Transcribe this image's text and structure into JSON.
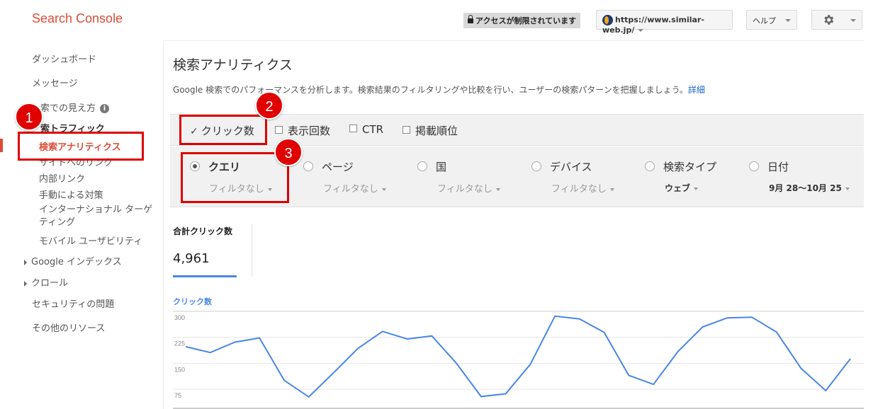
{
  "header": {
    "brand": "Search Console",
    "restricted_label": "アクセスが制限されています",
    "site": "https://www.similar-web.jp/",
    "help": "ヘルプ"
  },
  "sidebar": {
    "dashboard": "ダッシュボード",
    "messages": "メッセージ",
    "search_appearance": "索での見え方",
    "search_traffic": "索トラフィック",
    "search_analytics": "検索アナリティクス",
    "links_to_site": "サイトへのリンク",
    "internal_links": "内部リンク",
    "manual_actions": "手動による対策",
    "intl_targeting": "インターナショナル ターゲティング",
    "mobile_usability": "モバイル ユーザビリティ",
    "google_index": "Google インデックス",
    "crawl": "クロール",
    "security": "セキュリティの問題",
    "other_resources": "その他のリソース"
  },
  "main": {
    "title": "検索アナリティクス",
    "description": "Google 検索でのパフォーマンスを分析します。検索結果のフィルタリングや比較を行い、ユーザーの検索パターンを把握しましょう。",
    "description_link": "詳細",
    "metrics": [
      {
        "label": "クリック数",
        "checked": true
      },
      {
        "label": "表示回数",
        "checked": false
      },
      {
        "label": "CTR",
        "checked": false
      },
      {
        "label": "掲載順位",
        "checked": false
      }
    ],
    "groups": [
      {
        "label": "クエリ",
        "filter": "フィルタなし",
        "selected": true
      },
      {
        "label": "ページ",
        "filter": "フィルタなし",
        "selected": false
      },
      {
        "label": "国",
        "filter": "フィルタなし",
        "selected": false
      },
      {
        "label": "デバイス",
        "filter": "フィルタなし",
        "selected": false
      },
      {
        "label": "検索タイプ",
        "filter": "ウェブ",
        "selected": false
      },
      {
        "label": "日付",
        "filter": "9月 28～10月 25",
        "selected": false
      }
    ],
    "total_label": "合計クリック数",
    "total_value": "4,961",
    "chart_label": "クリック数"
  },
  "annotations": [
    "1",
    "2",
    "3"
  ],
  "chart_data": {
    "type": "line",
    "title": "",
    "ylabel": "クリック数",
    "yticks": [
      300,
      225,
      150,
      75
    ],
    "ylim": [
      20,
      310
    ],
    "series": [
      {
        "values": [
          200,
          183,
          213,
          225,
          103,
          55,
          124,
          195,
          244,
          222,
          231,
          152,
          56,
          64,
          149,
          288,
          280,
          241,
          117,
          91,
          186,
          257,
          283,
          285,
          242,
          137,
          73,
          165
        ]
      }
    ],
    "color": "#4a86e8"
  },
  "colors": {
    "brand": "#dd4b39",
    "annotation": "#e00000",
    "accent": "#4a86e8"
  }
}
